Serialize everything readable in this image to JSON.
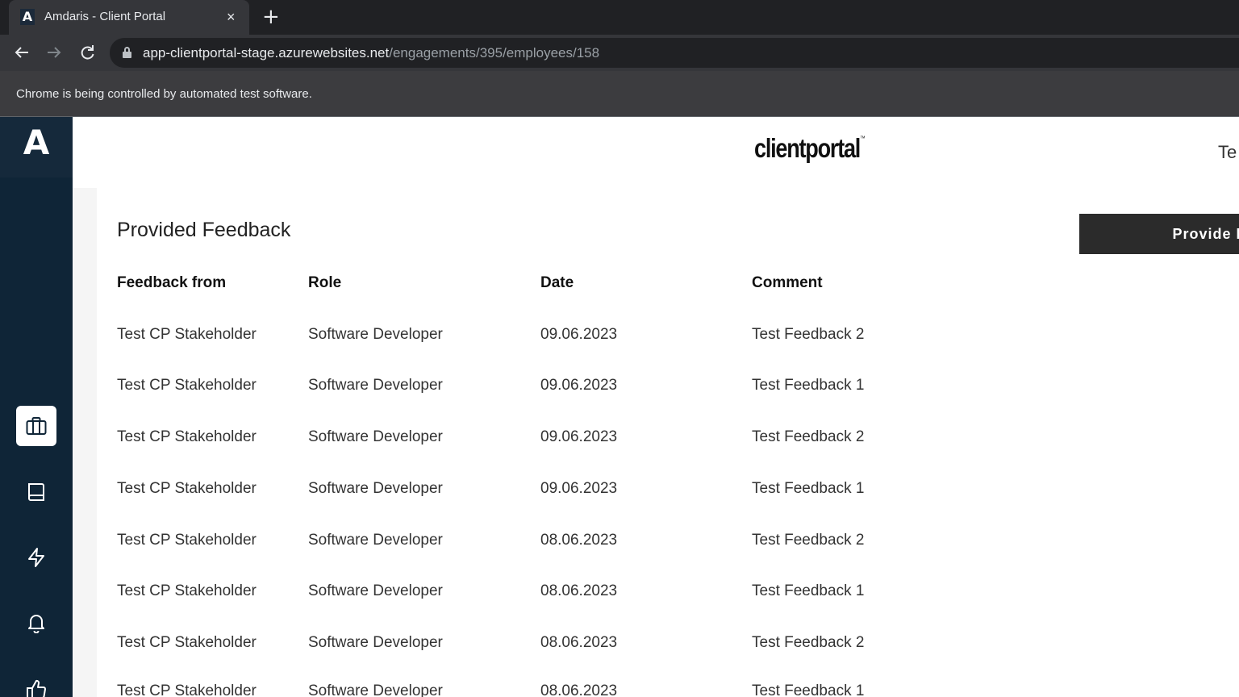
{
  "browser": {
    "tab_title": "Amdaris - Client Portal",
    "tab_favicon": "A",
    "close_icon": "×",
    "new_tab_icon": "+",
    "url_host": "app-clientportal-stage.azurewebsites.net",
    "url_path": "/engagements/395/employees/158",
    "infobar_text": "Chrome is being controlled by automated test software."
  },
  "sidebar": {
    "logo": "A",
    "items": [
      {
        "name": "briefcase-icon",
        "active": true
      },
      {
        "name": "book-icon",
        "active": false
      },
      {
        "name": "lightning-icon",
        "active": false
      },
      {
        "name": "bell-icon",
        "active": false
      },
      {
        "name": "thumbs-up-icon",
        "active": false
      }
    ]
  },
  "header": {
    "brand": "clientportal",
    "brand_tm": "™",
    "user_name": "Te"
  },
  "main": {
    "title": "Provided Feedback",
    "provide_button": "Provide Fe",
    "columns": [
      "Feedback from",
      "Role",
      "Date",
      "Comment"
    ],
    "rows": [
      [
        "Test CP Stakeholder",
        "Software Developer",
        "09.06.2023",
        "Test Feedback 2"
      ],
      [
        "Test CP Stakeholder",
        "Software Developer",
        "09.06.2023",
        "Test Feedback 1"
      ],
      [
        "Test CP Stakeholder",
        "Software Developer",
        "09.06.2023",
        "Test Feedback 2"
      ],
      [
        "Test CP Stakeholder",
        "Software Developer",
        "09.06.2023",
        "Test Feedback 1"
      ],
      [
        "Test CP Stakeholder",
        "Software Developer",
        "08.06.2023",
        "Test Feedback 2"
      ],
      [
        "Test CP Stakeholder",
        "Software Developer",
        "08.06.2023",
        "Test Feedback 1"
      ],
      [
        "Test CP Stakeholder",
        "Software Developer",
        "08.06.2023",
        "Test Feedback 2"
      ],
      [
        "Test CP Stakeholder",
        "Software Developer",
        "08.06.2023",
        "Test Feedback 1"
      ]
    ]
  },
  "colors": {
    "sidebar_bg": "#0f2537",
    "button_bg": "#2b2b2b"
  }
}
